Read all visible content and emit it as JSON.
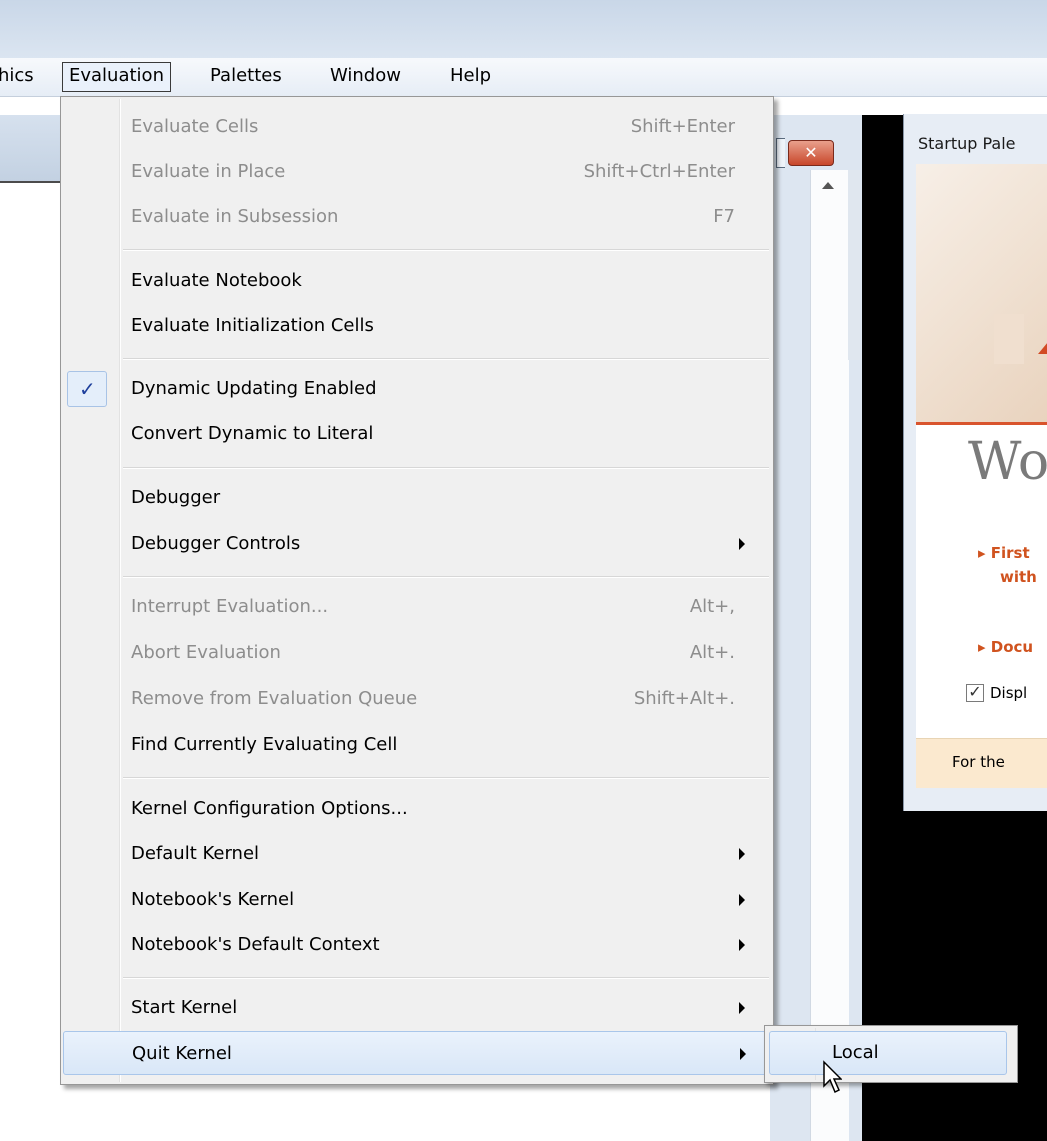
{
  "menubar": {
    "items": [
      {
        "label": "hics"
      },
      {
        "label": "Evaluation"
      },
      {
        "label": "Palettes"
      },
      {
        "label": "Window"
      },
      {
        "label": "Help"
      }
    ]
  },
  "menu": {
    "items": [
      {
        "label": "Evaluate Cells",
        "shortcut": "Shift+Enter"
      },
      {
        "label": "Evaluate in Place",
        "shortcut": "Shift+Ctrl+Enter"
      },
      {
        "label": "Evaluate in Subsession",
        "shortcut": "F7"
      },
      {
        "label": "Evaluate Notebook",
        "shortcut": ""
      },
      {
        "label": "Evaluate Initialization Cells",
        "shortcut": ""
      },
      {
        "label": "Dynamic Updating Enabled",
        "shortcut": ""
      },
      {
        "label": "Convert Dynamic to Literal",
        "shortcut": ""
      },
      {
        "label": "Debugger",
        "shortcut": ""
      },
      {
        "label": "Debugger Controls",
        "shortcut": ""
      },
      {
        "label": "Interrupt Evaluation...",
        "shortcut": "Alt+,"
      },
      {
        "label": "Abort Evaluation",
        "shortcut": "Alt+."
      },
      {
        "label": "Remove from Evaluation Queue",
        "shortcut": "Shift+Alt+."
      },
      {
        "label": "Find Currently Evaluating Cell",
        "shortcut": ""
      },
      {
        "label": "Kernel Configuration Options...",
        "shortcut": ""
      },
      {
        "label": "Default Kernel",
        "shortcut": ""
      },
      {
        "label": "Notebook's Kernel",
        "shortcut": ""
      },
      {
        "label": "Notebook's Default Context",
        "shortcut": ""
      },
      {
        "label": "Start Kernel",
        "shortcut": ""
      },
      {
        "label": "Quit Kernel",
        "shortcut": ""
      }
    ],
    "check_glyph": "✓"
  },
  "submenu": {
    "items": [
      {
        "label": "Local"
      }
    ]
  },
  "notebook": {
    "close_glyph": "✕"
  },
  "palette": {
    "title": "Startup Pale",
    "word": "Wo",
    "link1_line1": "▸ First",
    "link1_line2": "with",
    "link2": "▸ Docu",
    "checkbox_label": "Displ",
    "checkbox_glyph": "✓",
    "footer": "For the"
  },
  "colors": {
    "accent_check": "#1e3f9c",
    "highlight": "#d9e7f7",
    "palette_link": "#d0531f"
  }
}
